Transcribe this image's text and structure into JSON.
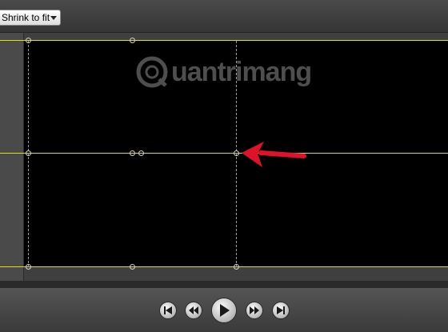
{
  "toolbar": {
    "zoom_value": "Shrink to fit"
  },
  "watermark": {
    "text": "uantrimang"
  },
  "colors": {
    "guide_line": "#e6e000",
    "arrow": "#e0112b"
  },
  "icons": {
    "first": "skip-to-start-icon",
    "rewind": "rewind-icon",
    "play": "play-icon",
    "forward": "fast-forward-icon",
    "last": "skip-to-end-icon"
  }
}
